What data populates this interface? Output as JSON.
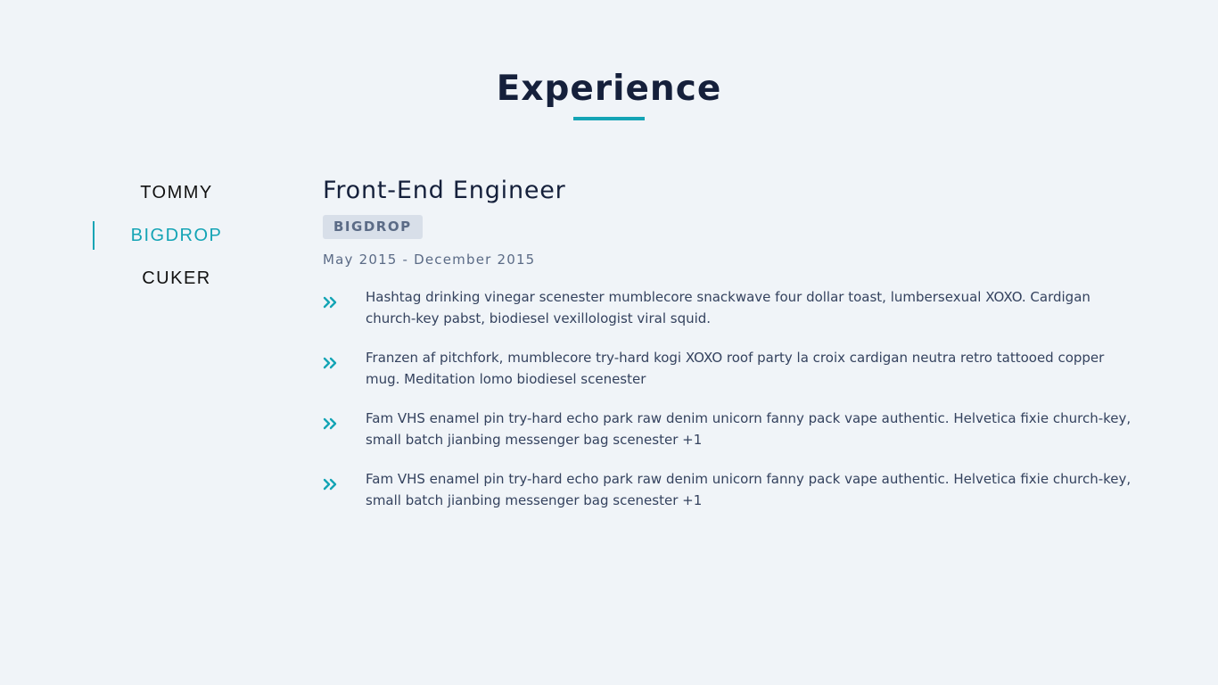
{
  "section": {
    "title": "Experience"
  },
  "tabs": [
    {
      "label": "TOMMY",
      "active": false
    },
    {
      "label": "BIGDROP",
      "active": true
    },
    {
      "label": "CUKER",
      "active": false
    }
  ],
  "job": {
    "title": "Front-End Engineer",
    "company": "BIGDROP",
    "range": "May 2015 - December 2015",
    "duties": [
      "Hashtag drinking vinegar scenester mumblecore snackwave four dollar toast, lumbersexual XOXO. Cardigan church-key pabst, biodiesel vexillologist viral squid.",
      "Franzen af pitchfork, mumblecore try-hard kogi XOXO roof party la croix cardigan neutra retro tattooed copper mug. Meditation lomo biodiesel scenester",
      "Fam VHS enamel pin try-hard echo park raw denim unicorn fanny pack vape authentic. Helvetica fixie church-key, small batch jianbing messenger bag scenester +1",
      "Fam VHS enamel pin try-hard echo park raw denim unicorn fanny pack vape authentic. Helvetica fixie church-key, small batch jianbing messenger bag scenester +1"
    ]
  },
  "icons": {
    "bullet": "double-chevron-right-icon"
  },
  "colors": {
    "background": "#f0f4f8",
    "accent": "#14a4b5",
    "heading": "#15203b",
    "muted": "#5b6b86",
    "badge_background": "#d8dfe9",
    "body_text": "#34425e"
  }
}
